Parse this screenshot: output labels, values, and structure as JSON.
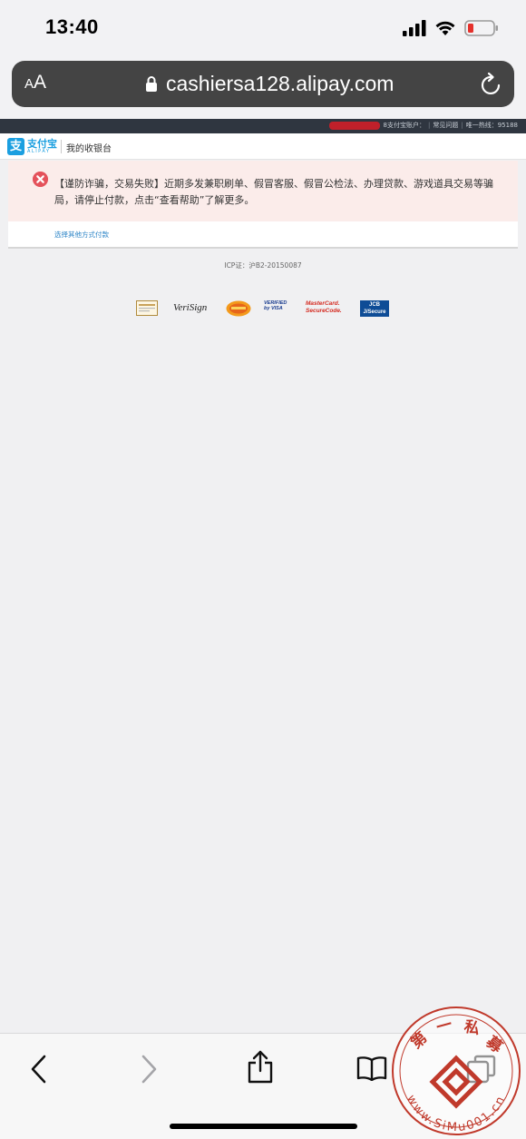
{
  "status_bar": {
    "time": "13:40"
  },
  "browser": {
    "text_size_small": "A",
    "text_size_large": "A",
    "url": "cashiersa128.alipay.com"
  },
  "site_topbar": {
    "account_label": "8支付宝账户：",
    "faq": "常见问题",
    "hotline": "唯一热线：95188"
  },
  "site_header": {
    "logo_cn": "支付宝",
    "logo_en": "ALIPAY",
    "title": "我的收银台"
  },
  "alert": {
    "message": "【谨防诈骗，交易失败】近期多发兼职刷单、假冒客服、假冒公检法、办理贷款、游戏道具交易等骗局，请停止付款，点击“查看帮助”了解更多。"
  },
  "pay_other_link": "选择其他方式付款",
  "icp": "ICP证：沪B2-20150087",
  "trust_badges": [
    {
      "name": "VeriSign"
    },
    {
      "name": "VERIFIED by VISA"
    },
    {
      "name": "MasterCard. SecureCode."
    },
    {
      "name": "JCB J/Secure"
    }
  ],
  "watermark": {
    "chars": [
      "第",
      "一",
      "私",
      "募"
    ],
    "url": "www.SiMu001.cn"
  },
  "colors": {
    "alipay_blue": "#1b9fe0",
    "alert_bg": "#fbecea",
    "alert_icon": "#e4525b",
    "link": "#2a83c6",
    "watermark_red": "#c0392b"
  }
}
